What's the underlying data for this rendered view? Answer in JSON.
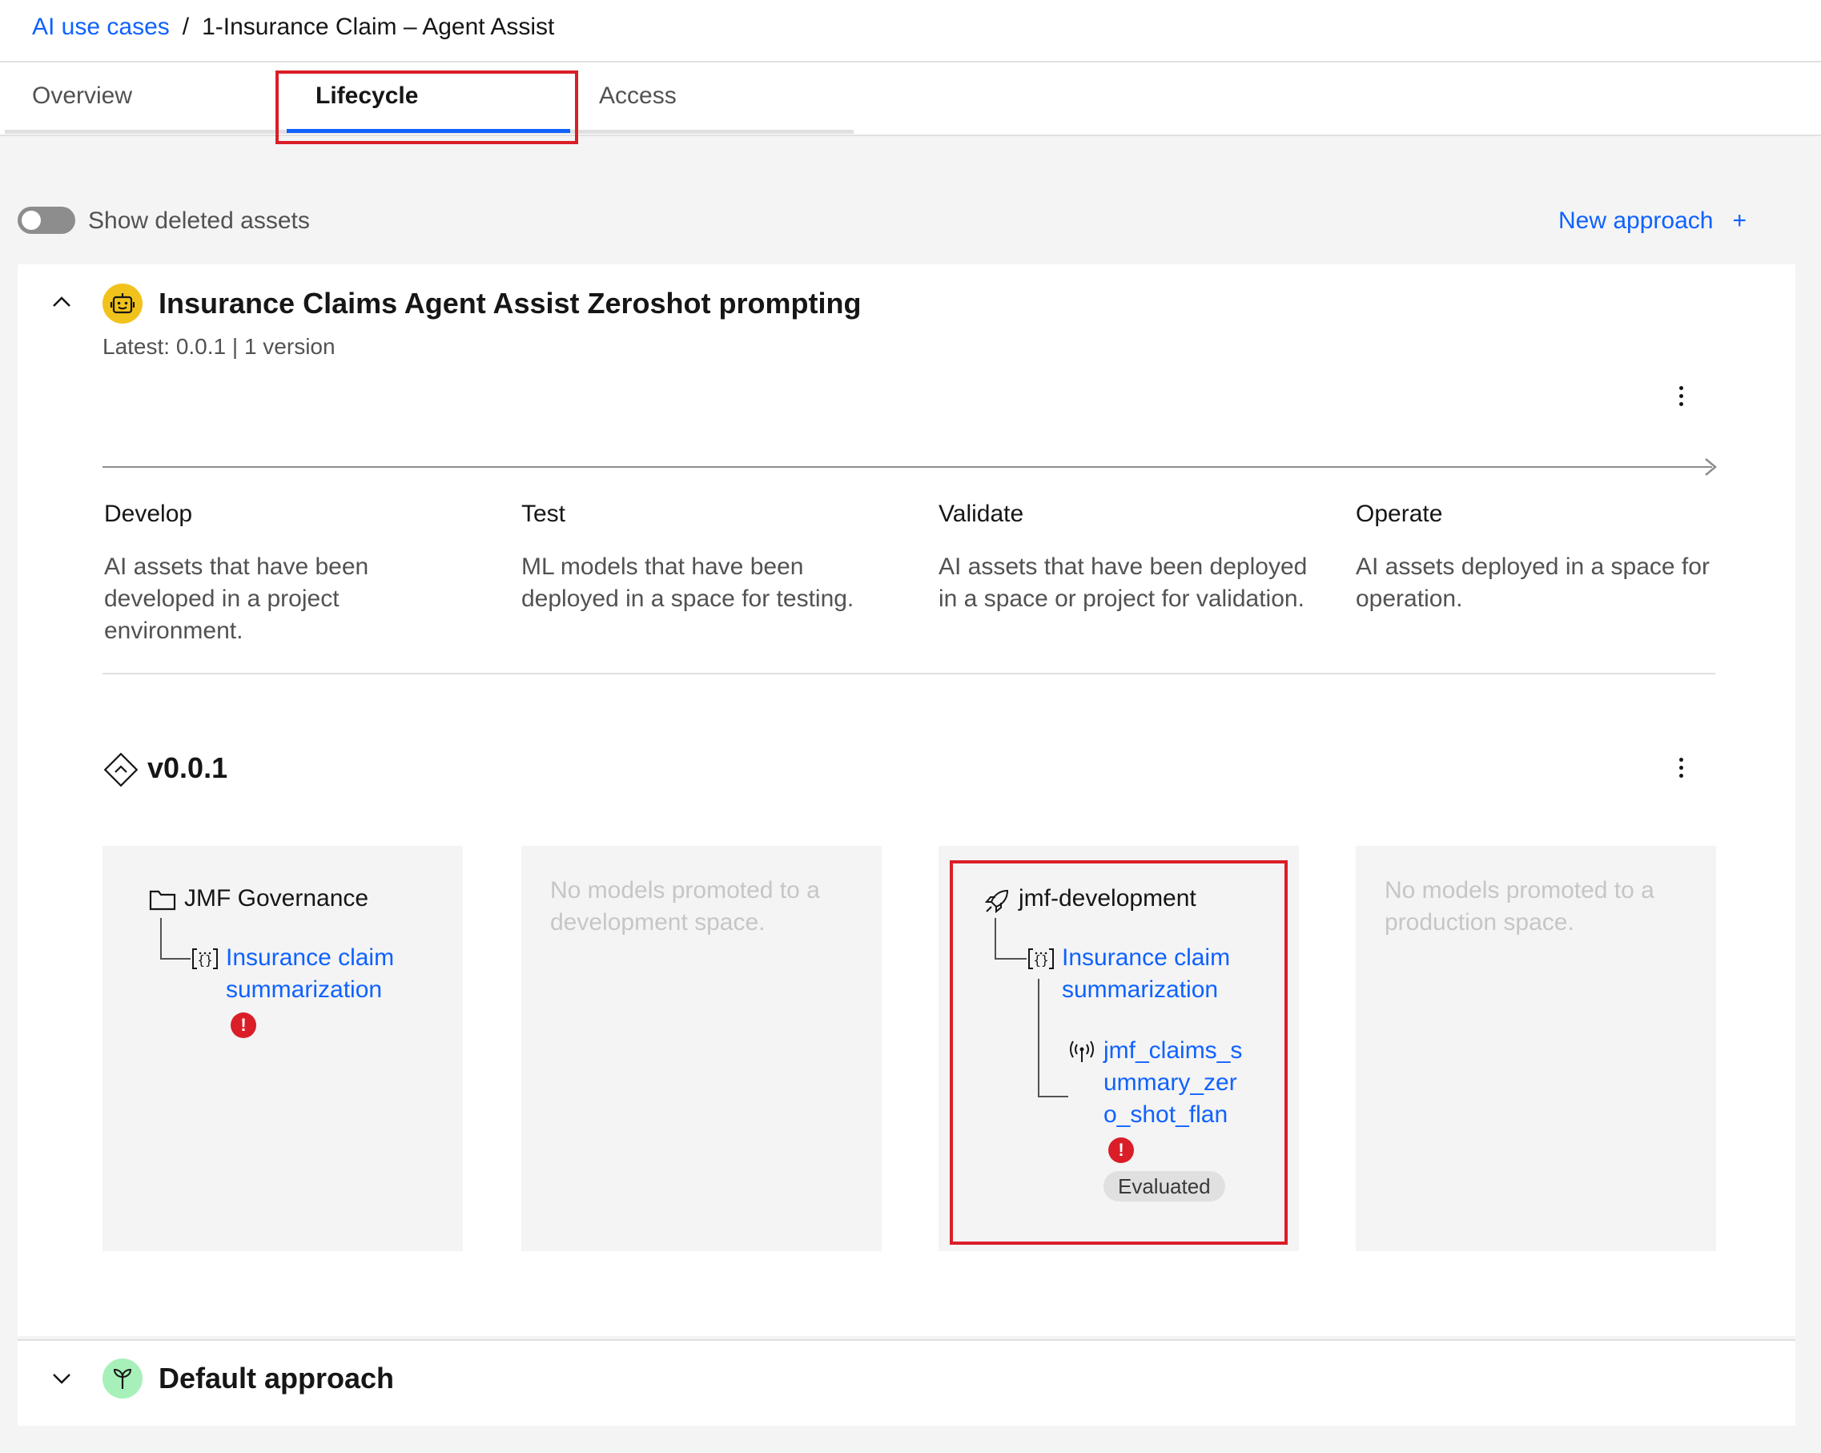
{
  "breadcrumb": {
    "parent": "AI use cases",
    "separator": "/",
    "current": "1-Insurance Claim – Agent Assist"
  },
  "tabs": [
    "Overview",
    "Lifecycle",
    "Access"
  ],
  "active_tab": "Lifecycle",
  "toolbar": {
    "toggle_label": "Show deleted assets",
    "toggle_on": false,
    "new_approach_label": "New approach",
    "new_approach_icon": "+"
  },
  "approach": {
    "title": "Insurance Claims Agent Assist Zeroshot prompting",
    "icon": "robot-icon",
    "latest": "Latest: 0.0.1 | 1 version",
    "expanded": true
  },
  "phases": [
    {
      "title": "Develop",
      "description": "AI assets that have been developed in a project environment."
    },
    {
      "title": "Test",
      "description": "ML models that have been deployed in a space for testing."
    },
    {
      "title": "Validate",
      "description": "AI assets that have been deployed in a space or project for validation."
    },
    {
      "title": "Operate",
      "description": "AI assets deployed in a space for operation."
    }
  ],
  "version": {
    "label": "v0.0.1",
    "develop": {
      "container": "JMF Governance",
      "container_icon": "folder-icon",
      "asset_line1": "Insurance claim",
      "asset_line2": "summarization",
      "asset_icon": "prompt-template-icon",
      "has_error": true
    },
    "test": {
      "empty_text": "No models promoted to a development space."
    },
    "validate": {
      "container": "jmf-development",
      "container_icon": "rocket-icon",
      "asset_line1": "Insurance claim",
      "asset_line2": "summarization",
      "asset_icon": "prompt-template-icon",
      "deployment_line1": "jmf_claims_s",
      "deployment_line2": "ummary_zer",
      "deployment_line3": "o_shot_flan",
      "deployment_icon": "deployment-icon",
      "has_error": true,
      "tag": "Evaluated"
    },
    "operate": {
      "empty_text": "No models promoted to a production space."
    }
  },
  "second_approach": {
    "title": "Default approach",
    "icon": "sprout-icon",
    "expanded": false
  },
  "colors": {
    "link": "#0f62fe",
    "error": "#da1e28",
    "highlight": "#da1e28",
    "robot_bg": "#f1c21b",
    "sprout_bg": "#a7f0ba"
  }
}
